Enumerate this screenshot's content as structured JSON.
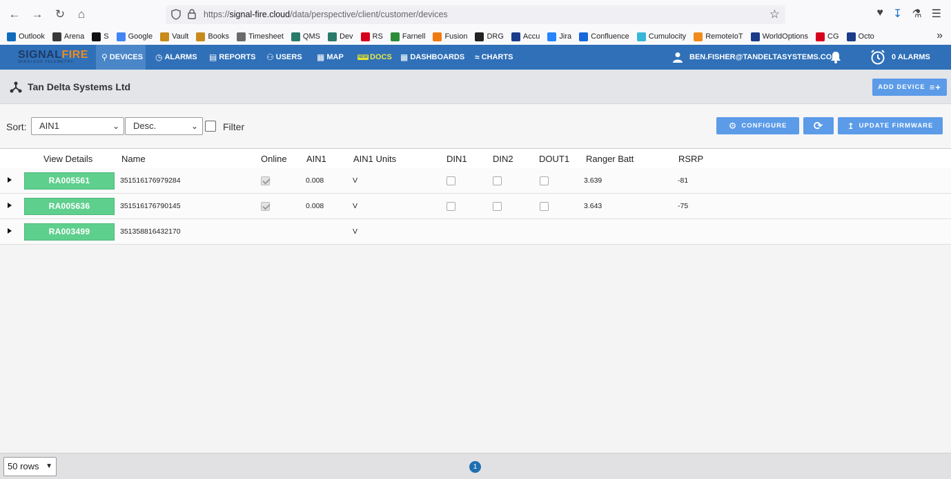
{
  "browser": {
    "url_prefix": "https://",
    "url_host": "signal-fire.cloud",
    "url_path": "/data/perspective/client/customer/devices",
    "bookmarks": [
      {
        "label": "Outlook",
        "color": "#0f6cbd"
      },
      {
        "label": "Arena",
        "color": "#3a3a3a"
      },
      {
        "label": "S",
        "color": "#111111"
      },
      {
        "label": "Google",
        "color": "#4285f4"
      },
      {
        "label": "Vault",
        "color": "#c98a1c"
      },
      {
        "label": "Books",
        "color": "#c98a1c"
      },
      {
        "label": "Timesheet",
        "color": "#6b6b6b"
      },
      {
        "label": "QMS",
        "color": "#2a7a6a"
      },
      {
        "label": "Dev",
        "color": "#2a7a6a"
      },
      {
        "label": "RS",
        "color": "#d6001c"
      },
      {
        "label": "Farnell",
        "color": "#2e8b3a"
      },
      {
        "label": "Fusion",
        "color": "#f07a10"
      },
      {
        "label": "DRG",
        "color": "#222222"
      },
      {
        "label": "Accu",
        "color": "#1a3c8a"
      },
      {
        "label": "Jira",
        "color": "#2684ff"
      },
      {
        "label": "Confluence",
        "color": "#1868db"
      },
      {
        "label": "Cumulocity",
        "color": "#38b6d8"
      },
      {
        "label": "RemoteIoT",
        "color": "#f08a1c"
      },
      {
        "label": "WorldOptions",
        "color": "#1a3c8a"
      },
      {
        "label": "CG",
        "color": "#d6001c"
      },
      {
        "label": "Octo",
        "color": "#1a3c8a"
      }
    ]
  },
  "app": {
    "logo_signal": "SIGNAL",
    "logo_fire": "FIRE",
    "logo_tagline": "WIRELESS TELEMETRY",
    "nav": {
      "devices": "DEVICES",
      "alarms": "ALARMS",
      "reports": "REPORTS",
      "users": "USERS",
      "map": "MAP",
      "docs_badge": "NEW",
      "docs": "DOCS",
      "dashboards": "DASHBOARDS",
      "charts": "CHARTS"
    },
    "user_email": "BEN.FISHER@TANDELTASYSTEMS.COI",
    "alarm_count": "0 ALARMS"
  },
  "org": {
    "title": "Tan Delta Systems Ltd",
    "add_device": "ADD DEVICE"
  },
  "toolbar": {
    "sort_label": "Sort:",
    "sort_field": "AIN1",
    "sort_order": "Desc.",
    "filter_label": "Filter",
    "configure": "CONFIGURE",
    "update_firmware": "UPDATE FIRMWARE"
  },
  "table": {
    "columns": [
      "View Details",
      "Name",
      "Online",
      "AIN1",
      "AIN1 Units",
      "DIN1",
      "DIN2",
      "DOUT1",
      "Ranger Batt",
      "RSRP"
    ],
    "rows": [
      {
        "device": "RA005561",
        "name": "351516176979284",
        "online": true,
        "ain1": "0.008",
        "units": "V",
        "din1": false,
        "din2": false,
        "dout1": false,
        "batt": "3.639",
        "rsrp": "-81",
        "has_data": true
      },
      {
        "device": "RA005636",
        "name": "351516176790145",
        "online": true,
        "ain1": "0.008",
        "units": "V",
        "din1": false,
        "din2": false,
        "dout1": false,
        "batt": "3.643",
        "rsrp": "-75",
        "has_data": true
      },
      {
        "device": "RA003499",
        "name": "351358816432170",
        "online": null,
        "ain1": "",
        "units": "V",
        "din1": null,
        "din2": null,
        "dout1": null,
        "batt": "",
        "rsrp": "",
        "has_data": false
      }
    ]
  },
  "footer": {
    "rows_per_page": "50 rows",
    "current_page": "1"
  }
}
